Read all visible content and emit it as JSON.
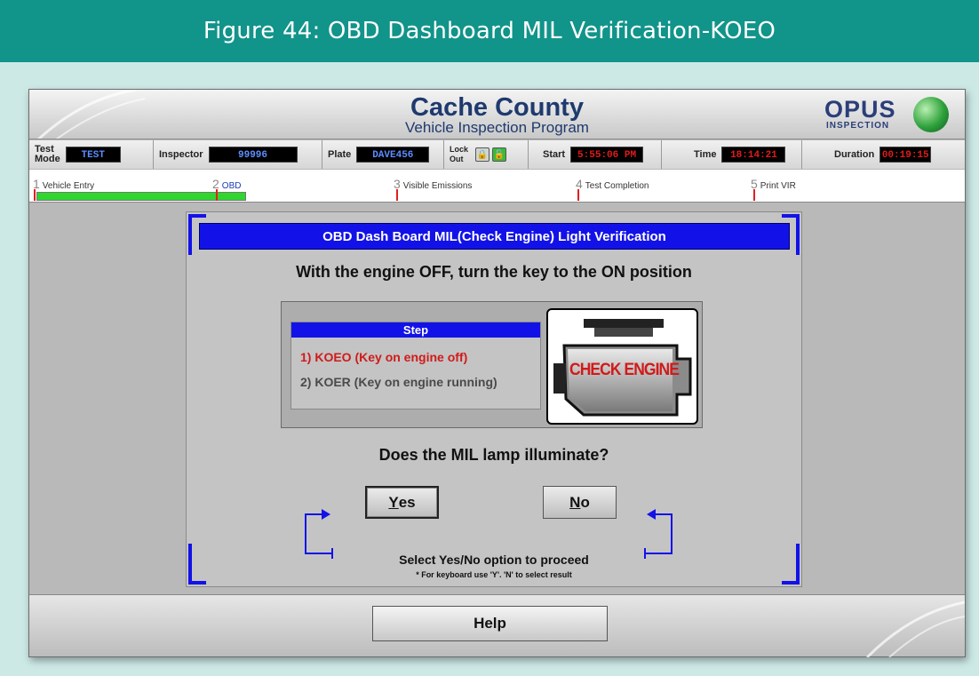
{
  "figure": {
    "caption": "Figure 44: OBD Dashboard MIL Verification-KOEO"
  },
  "banner": {
    "title": "Cache County",
    "subtitle": "Vehicle Inspection Program",
    "logo_word": "OPUS",
    "logo_sub": "INSPECTION"
  },
  "status": {
    "test_mode_label_1": "Test",
    "test_mode_label_2": "Mode",
    "test_mode_value": "TEST",
    "inspector_label": "Inspector",
    "inspector_value": "99996",
    "plate_label": "Plate",
    "plate_value": "DAVE456",
    "lockout_label_1": "Lock",
    "lockout_label_2": "Out",
    "start_label": "Start",
    "start_value": "5:55:06 PM",
    "time_label": "Time",
    "time_value": "18:14:21",
    "duration_label": "Duration",
    "duration_value": "00:19:15"
  },
  "progress": {
    "steps": [
      {
        "num": "1",
        "label": "Vehicle Entry"
      },
      {
        "num": "2",
        "label": "OBD"
      },
      {
        "num": "3",
        "label": "Visible Emissions"
      },
      {
        "num": "4",
        "label": "Test Completion"
      },
      {
        "num": "5",
        "label": "Print VIR"
      }
    ]
  },
  "panel": {
    "title": "OBD Dash Board MIL(Check Engine) Light Verification",
    "instruction": "With the engine OFF, turn the key to the ON position",
    "step_header": "Step",
    "step_1": "1) KOEO (Key on engine off)",
    "step_2": "2) KOER (Key on engine running)",
    "engine_label": "CHECK ENGINE",
    "question": "Does the MIL lamp illuminate?",
    "yes_first": "Y",
    "yes_rest": "es",
    "no_first": "N",
    "no_rest": "o",
    "select_text": "Select Yes/No option to proceed",
    "hint": "* For keyboard use 'Y'. 'N' to select result"
  },
  "footer": {
    "help_label": "Help"
  },
  "colors": {
    "header_teal": "#11948a",
    "panel_blue": "#1212e8",
    "active_red": "#d11a1a",
    "progress_green": "#2ed62e"
  }
}
